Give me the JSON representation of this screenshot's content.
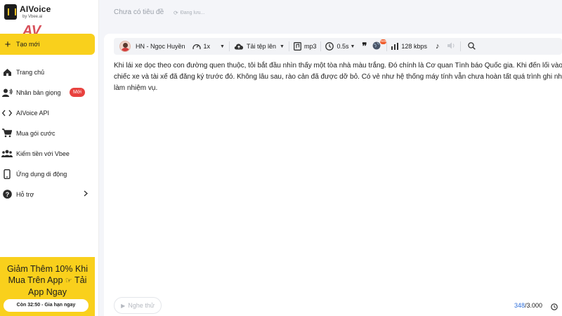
{
  "brand": {
    "name": "AIVoice",
    "sub": "by Vbee.ai",
    "watermark": "AV",
    "colors": {
      "accent": "#f9d01c",
      "badge": "#e8413e",
      "link": "#2f6fdb"
    }
  },
  "header": {
    "title": "Chưa có tiêu đề",
    "saving": "Đang lưu..."
  },
  "sidebar": {
    "create_label": "Tạo mới",
    "items": [
      {
        "label": "Trang chủ",
        "icon": "home-icon"
      },
      {
        "label": "Nhân bản giọng",
        "icon": "user-voice-icon",
        "badge": "Mới"
      },
      {
        "label": "AIVoice API",
        "icon": "code-icon"
      },
      {
        "label": "Mua gói cước",
        "icon": "cart-icon"
      },
      {
        "label": "Kiếm tiền với Vbee",
        "icon": "group-icon"
      },
      {
        "label": "Ứng dụng di động",
        "icon": "phone-icon"
      },
      {
        "label": "Hỗ trợ",
        "icon": "help-icon"
      }
    ],
    "promo": {
      "line1": "Giảm Thêm 10% Khi",
      "line2a": "Mua Trên App",
      "line2b": "Tải",
      "line3": "App Ngay",
      "button": "Còn 32:50 - Gia hạn ngay"
    }
  },
  "toolbar": {
    "voice": "HN - Ngọc Huyền",
    "speed": "1x",
    "upload": "Tải tệp lên",
    "format": "mp3",
    "pause": "0.5s",
    "bitrate": "128 kbps",
    "new_badge": "new"
  },
  "editor": {
    "content": "Khi lái xe dọc theo con đường quen thuộc, tôi bắt đầu nhìn thấy một tòa nhà màu trắng. Đó chính là Cơ quan Tình báo Quốc gia. Khi đến lối vào, chiếc xe và tài xế đã đăng ký trước đó. Không lâu sau, rào cản đã được dỡ bỏ. Có vẻ như hệ thống máy tính vẫn chưa hoàn tất quá trình ghi nhận làm nhiệm vụ.",
    "try_label": "Nghe thử",
    "char_count": "348",
    "char_limit": "/3.000"
  }
}
